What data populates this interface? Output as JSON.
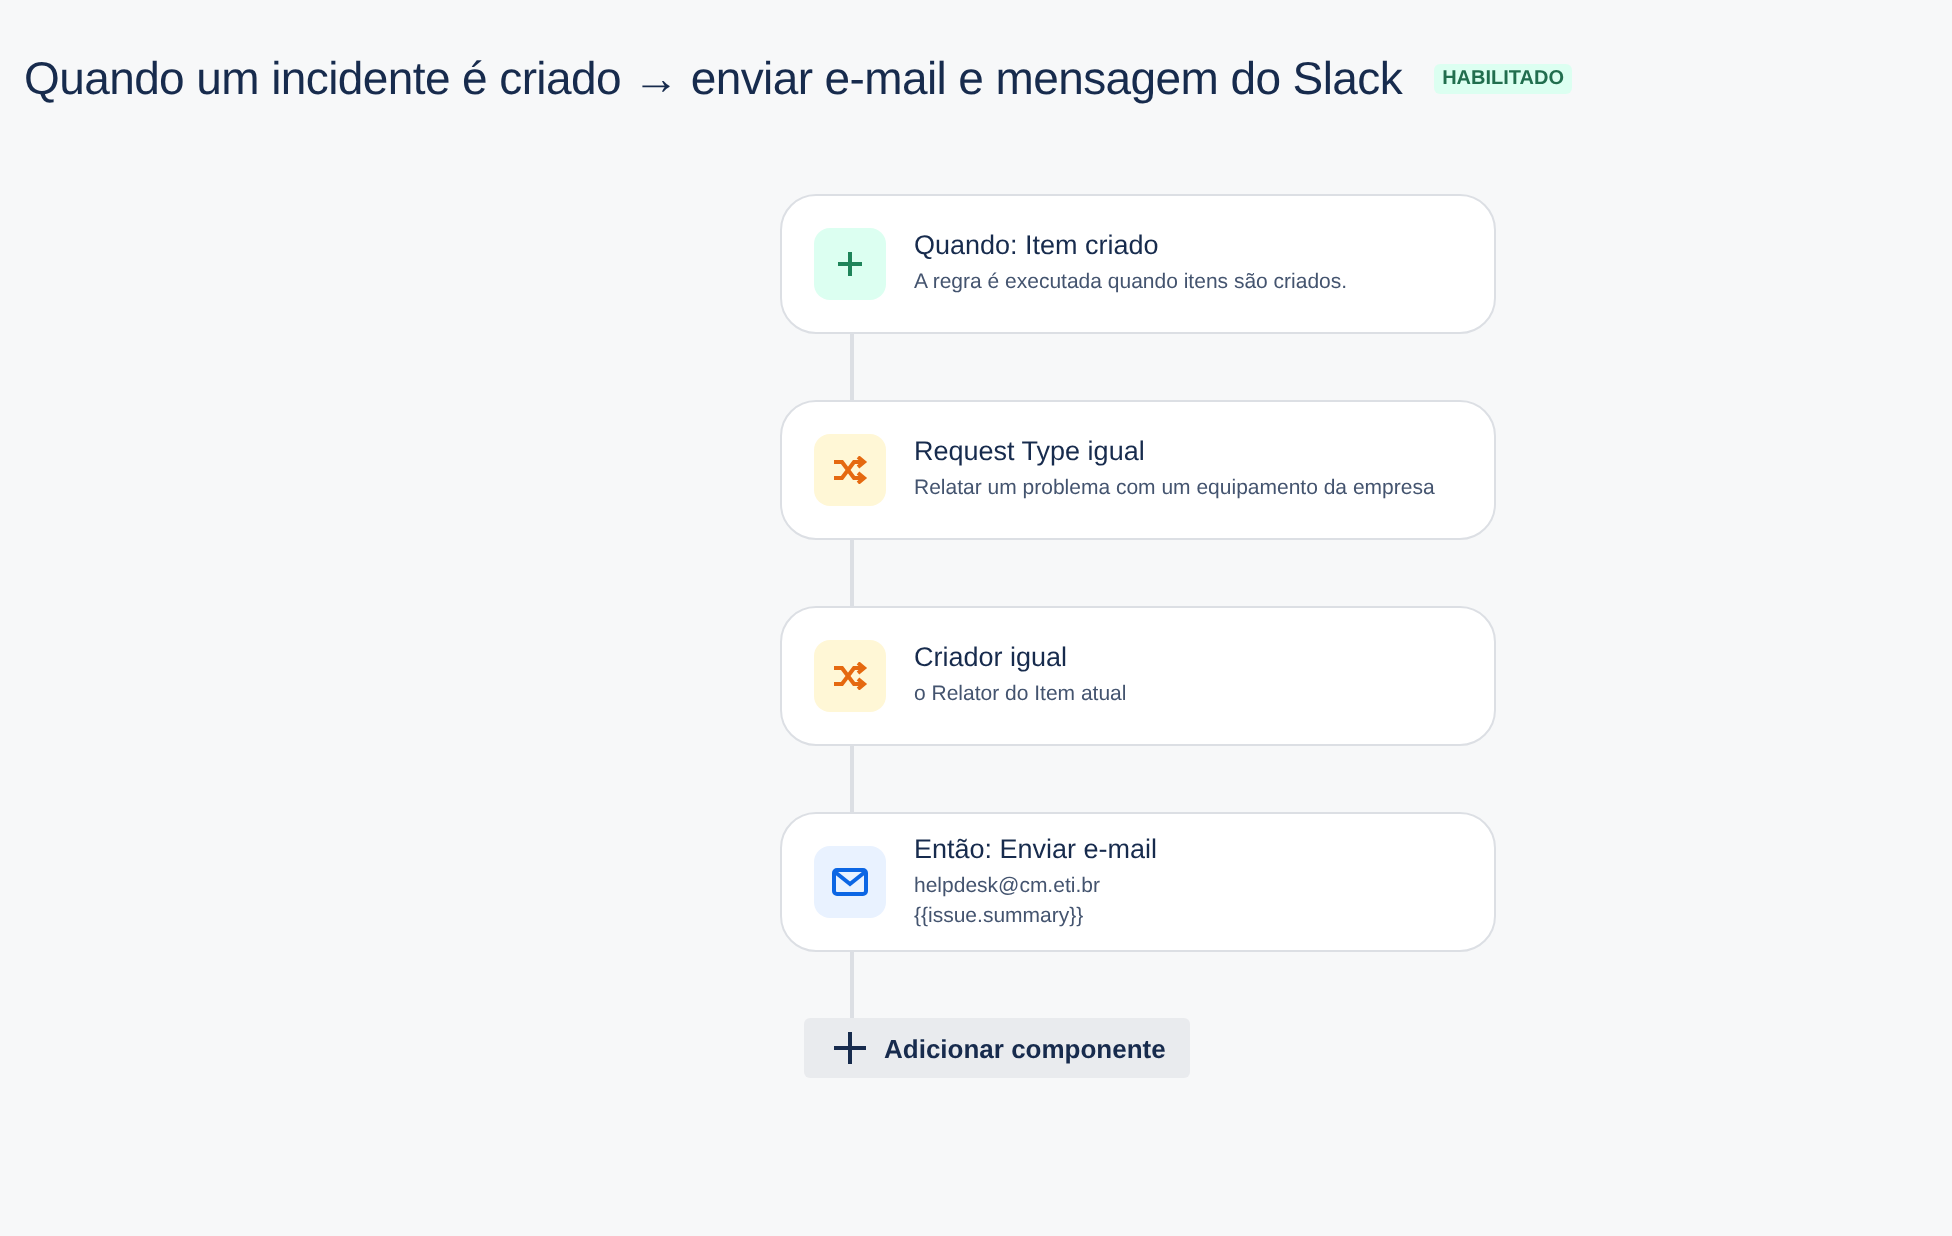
{
  "title": "Quando um incidente é criado → enviar e-mail e mensagem do Slack",
  "status": {
    "label": "HABILITADO",
    "enabled": true
  },
  "steps": [
    {
      "kind": "trigger",
      "title": "Quando: Item criado",
      "details": [
        "A regra é executada quando itens são criados."
      ]
    },
    {
      "kind": "condition",
      "title": "Request Type igual",
      "details": [
        "Relatar um problema com um equipamento da empresa"
      ]
    },
    {
      "kind": "condition",
      "title": "Criador igual",
      "details": [
        "o Relator do Item atual"
      ]
    },
    {
      "kind": "action",
      "title": "Então: Enviar e-mail",
      "details": [
        "helpdesk@cm.eti.br",
        "{{issue.summary}}"
      ]
    }
  ],
  "add_button": {
    "label": "Adicionar componente"
  }
}
